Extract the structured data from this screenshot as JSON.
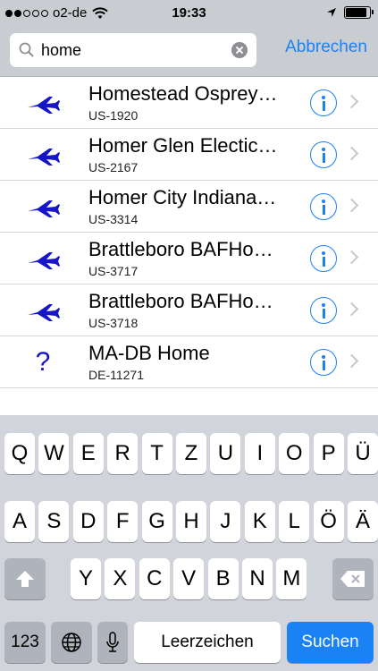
{
  "status_bar": {
    "carrier": "o2-de",
    "time": "19:33",
    "signal_bars_filled": 2,
    "signal_bars_total": 5,
    "battery_level": 0.9
  },
  "search": {
    "query": "home",
    "cancel_label": "Abbrechen"
  },
  "results": [
    {
      "icon": "airplane-icon",
      "title": "Homestead Osprey…",
      "subtitle": "US-1920"
    },
    {
      "icon": "airplane-icon",
      "title": "Homer Glen Electic…",
      "subtitle": "US-2167"
    },
    {
      "icon": "airplane-icon",
      "title": "Homer City Indiana…",
      "subtitle": "US-3314"
    },
    {
      "icon": "airplane-icon",
      "title": "Brattleboro BAFHo…",
      "subtitle": "US-3717"
    },
    {
      "icon": "airplane-icon",
      "title": "Brattleboro BAFHo…",
      "subtitle": "US-3718"
    },
    {
      "icon": "question-icon",
      "title": "MA-DB Home",
      "subtitle": "DE-11271",
      "glyph": "?"
    }
  ],
  "keyboard": {
    "row1": [
      "Q",
      "W",
      "E",
      "R",
      "T",
      "Z",
      "U",
      "I",
      "O",
      "P",
      "Ü"
    ],
    "row2": [
      "A",
      "S",
      "D",
      "F",
      "G",
      "H",
      "J",
      "K",
      "L",
      "Ö",
      "Ä"
    ],
    "row3": [
      "Y",
      "X",
      "C",
      "V",
      "B",
      "N",
      "M"
    ],
    "numbers_label": "123",
    "space_label": "Leerzeichen",
    "search_label": "Suchen"
  },
  "colors": {
    "accent": "#1a82f5",
    "airplane": "#1616c8",
    "bar_background": "#c9ccd1",
    "keyboard_background": "#d1d5db"
  }
}
